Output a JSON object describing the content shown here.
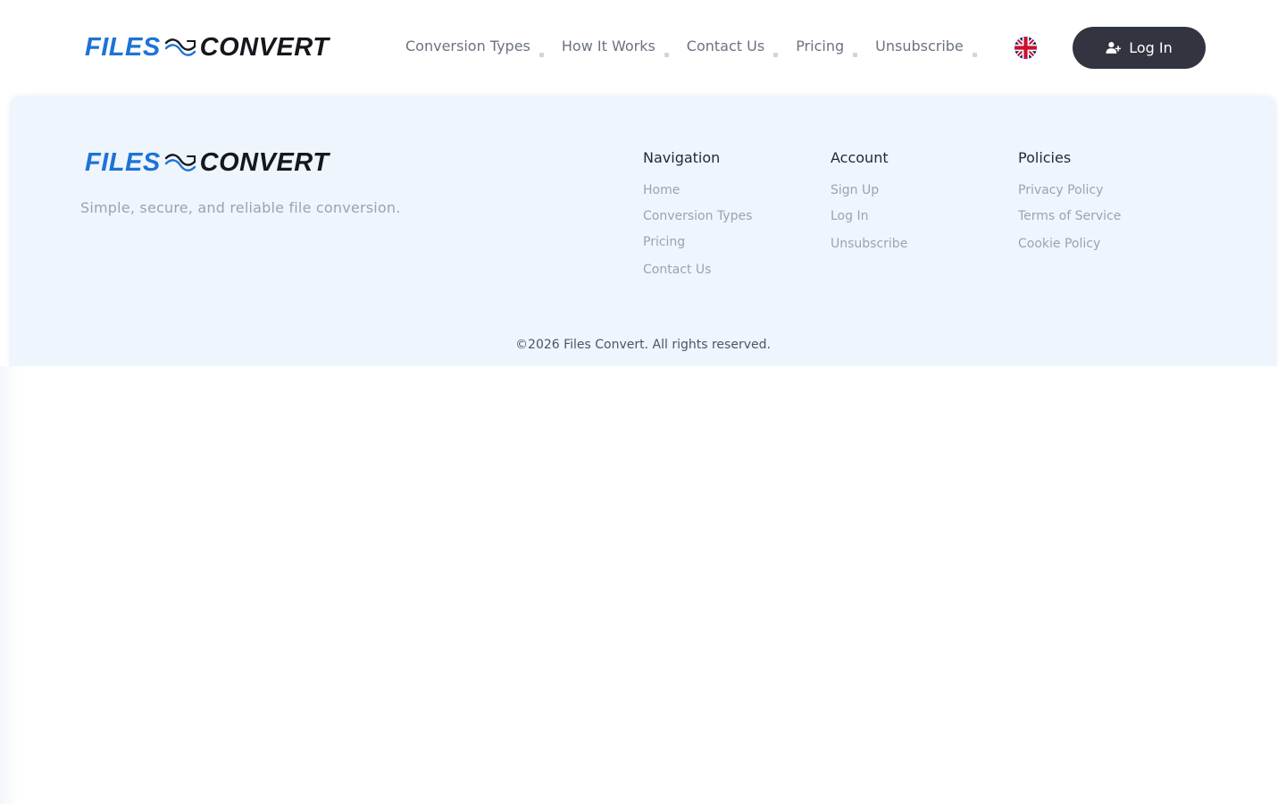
{
  "brand": {
    "word1": "FILES",
    "word2": "CONVERT",
    "color_primary": "#1d73d6",
    "color_dark": "#16171c"
  },
  "header": {
    "nav": [
      {
        "label": "Conversion Types"
      },
      {
        "label": "How It Works"
      },
      {
        "label": "Contact Us"
      },
      {
        "label": "Pricing"
      },
      {
        "label": "Unsubscribe"
      }
    ],
    "language_icon": "uk-flag-icon",
    "login_label": "Log In",
    "login_icon": "user-plus-icon"
  },
  "footer": {
    "tagline": "Simple, secure, and reliable file conversion.",
    "columns": [
      {
        "title": "Navigation",
        "links": [
          "Home",
          "Conversion Types",
          "Pricing",
          "Contact Us"
        ]
      },
      {
        "title": "Account",
        "links": [
          "Sign Up",
          "Log In",
          "Unsubscribe"
        ]
      },
      {
        "title": "Policies",
        "links": [
          "Privacy Policy",
          "Terms of Service",
          "Cookie Policy"
        ]
      }
    ],
    "copyright": "©2026 Files Convert. All rights reserved.",
    "background": "#eef5fd"
  },
  "colors": {
    "button_bg": "#32353f",
    "nav_text": "#6b7280",
    "link_text": "#9ca3af"
  }
}
